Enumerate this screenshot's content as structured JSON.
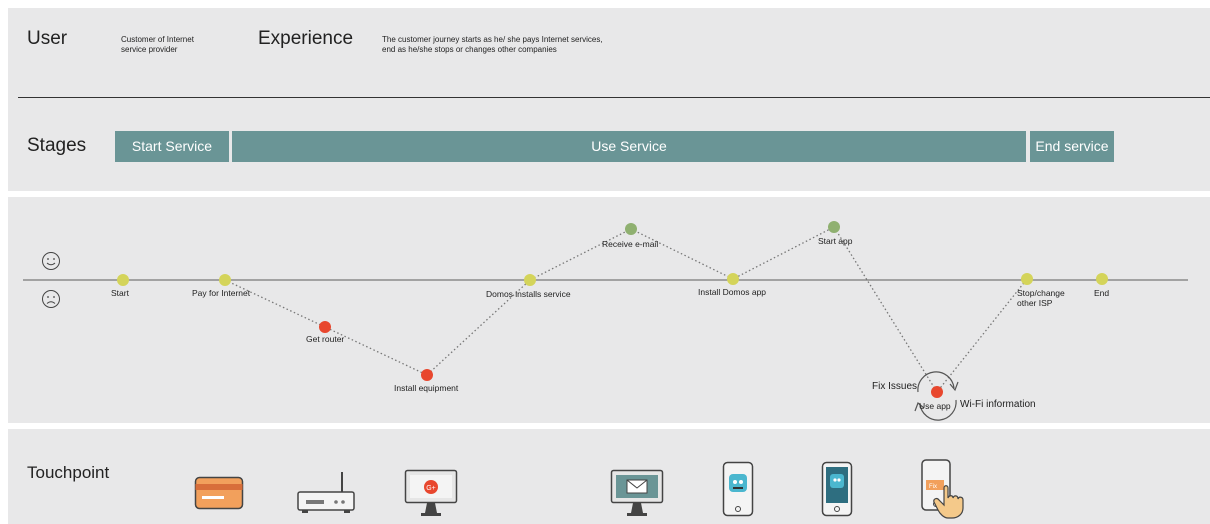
{
  "header": {
    "user_title": "User",
    "user_desc_line1": "Customer of Internet",
    "user_desc_line2": "service provider",
    "experience_title": "Experience",
    "experience_desc_line1": "The customer journey starts as he/ she pays Internet services,",
    "experience_desc_line2": "end as he/she stops or changes other companies"
  },
  "stages": {
    "title": "Stages",
    "items": [
      "Start Service",
      "Use Service",
      "End service"
    ],
    "color": "#6a9596"
  },
  "journey": {
    "faces": [
      "happy-face-icon",
      "sad-face-icon"
    ],
    "points": [
      {
        "label": "Start",
        "mood": "neutral"
      },
      {
        "label": "Pay for Internet",
        "mood": "neutral"
      },
      {
        "label": "Get router",
        "mood": "negative"
      },
      {
        "label": "Install equipment",
        "mood": "negative"
      },
      {
        "label": "Domos installs service",
        "mood": "neutral"
      },
      {
        "label": "Receive e-mail",
        "mood": "positive"
      },
      {
        "label": "Install Domos app",
        "mood": "neutral"
      },
      {
        "label": "Start app",
        "mood": "positive"
      },
      {
        "label": "Use app",
        "mood": "negative"
      },
      {
        "label": "Stop/change",
        "mood": "neutral"
      },
      {
        "label": "End",
        "mood": "neutral"
      }
    ],
    "stop_label_line2": "other ISP",
    "loop_labels": {
      "fix": "Fix Issues",
      "wifi": "Wi-Fi information"
    },
    "colors": {
      "neutral": "#d4d45a",
      "negative": "#e8472e",
      "positive": "#8fb070"
    }
  },
  "touchpoints": {
    "title": "Touchpoint",
    "items": [
      "credit-card-icon",
      "router-icon",
      "monitor-google-icon",
      "monitor-email-icon",
      "phone-app-icon",
      "phone-app-screen-icon",
      "phone-tap-icon"
    ]
  }
}
